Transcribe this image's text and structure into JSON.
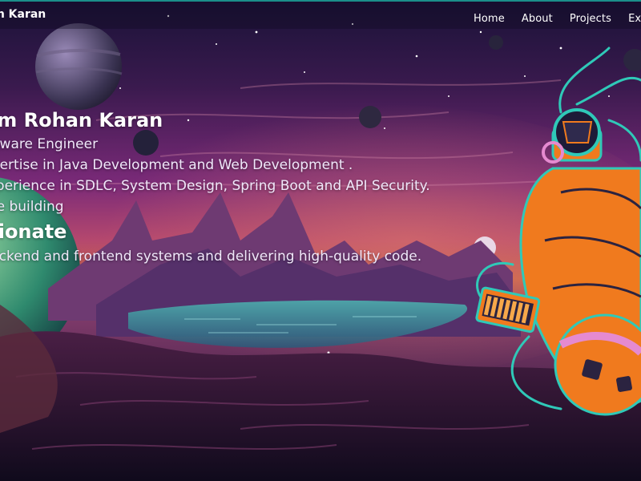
{
  "brand": {
    "name": "Rohan Karan"
  },
  "nav": {
    "items": [
      {
        "label": "Home"
      },
      {
        "label": "About"
      },
      {
        "label": "Projects"
      },
      {
        "label": "Experience"
      }
    ]
  },
  "hero": {
    "greeting_name": "I'm Rohan Karan",
    "role": "Software Engineer",
    "expertise": "Expertise in Java Development and Web Development .",
    "experience": "Experience in SDLC, System Design, Spring Boot and API Security.",
    "building": "I love building",
    "heading": "Passionate",
    "description": "about backend and frontend systems and delivering high-quality code."
  },
  "colors": {
    "nav_accent": "#1b8f8a",
    "text": "#ffffff",
    "astronaut_suit": "#f07a1e",
    "astronaut_outline": "#2fc9b8",
    "sky_purple": "#7a2a78",
    "horizon_orange": "#c9664a"
  }
}
